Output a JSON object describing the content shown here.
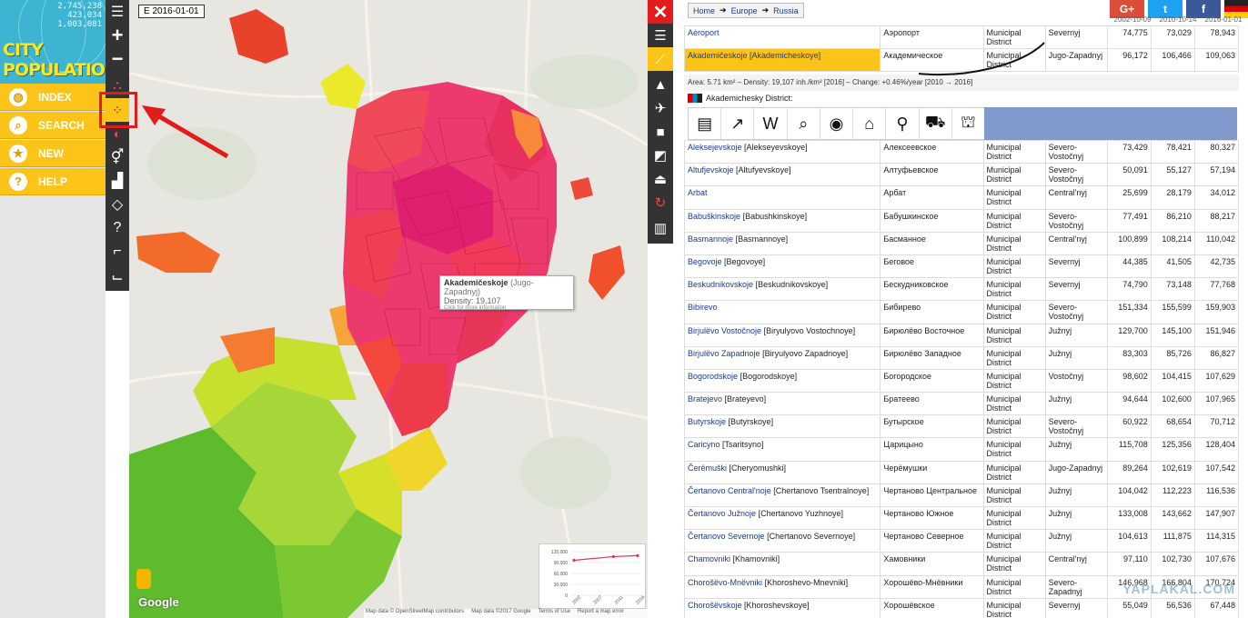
{
  "logo": {
    "stats": [
      "2,745,238",
      "423,034",
      "1,003,081"
    ],
    "title_line1": "CITY",
    "title_line2": "POPULATION"
  },
  "nav": [
    {
      "label": "INDEX",
      "icon": "globe-icon",
      "glyph": "◍"
    },
    {
      "label": "SEARCH",
      "icon": "search-icon",
      "glyph": "⌕"
    },
    {
      "label": "NEW",
      "icon": "star-icon",
      "glyph": "★"
    },
    {
      "label": "HELP",
      "icon": "help-icon",
      "glyph": "?"
    }
  ],
  "map": {
    "date": "E 2016-01-01",
    "tooltip": {
      "name": "Akademičeskoje",
      "region": "(Jugo-Zapadnyj)",
      "density": "Density: 19,107",
      "more": "Click for more information"
    },
    "google": "Google",
    "footer": [
      "Map data © OpenStreetMap contributors",
      "Map data ©2017 Google",
      "Terms of Use",
      "Report a map error"
    ],
    "mini_chart": {
      "y_ticks": [
        "120,000",
        "90,000",
        "60,000",
        "30,000",
        "0"
      ],
      "x_ticks": [
        "2002",
        "2007",
        "2011",
        "2016"
      ]
    }
  },
  "chart_data": {
    "type": "line",
    "x": [
      "2002",
      "2010",
      "2016"
    ],
    "series": [
      {
        "values": [
          96172,
          106466,
          109063
        ]
      }
    ],
    "ylim": [
      0,
      120000
    ]
  },
  "breadcrumb": [
    "Home",
    "Europe",
    "Russia"
  ],
  "social": [
    {
      "label": "G+",
      "color": "#dd4b39"
    },
    {
      "label": "t",
      "color": "#1da1f2"
    },
    {
      "label": "f",
      "color": "#3b5998"
    }
  ],
  "col_dates": [
    "2002-10-09",
    "2010-10-14",
    "2016-01-01"
  ],
  "top_rows": [
    {
      "lat": "Aėroport",
      "alt": "",
      "cyr": "Аэропорт",
      "type": "Municipal District",
      "region": "Severnyj",
      "p1": "74,775",
      "p2": "73,029",
      "p3": "78,943",
      "selected": false
    },
    {
      "lat": "Akademičeskoje",
      "alt": "[Akademicheskoye]",
      "cyr": "Академическое",
      "type": "Municipal District",
      "region": "Jugo-Zapadnyj",
      "p1": "96,172",
      "p2": "106,466",
      "p3": "109,063",
      "selected": true
    }
  ],
  "detail": {
    "info": "Area: 5.71 km² – Density: 19,107 inh./km² [2016] – Change: +0.46%/year [2010 → 2016]",
    "sub": "Akademichesky District:"
  },
  "icon_row": [
    {
      "name": "document-icon",
      "glyph": "▤"
    },
    {
      "name": "line-chart-icon",
      "glyph": "↗"
    },
    {
      "name": "wikipedia-icon",
      "glyph": "W"
    },
    {
      "name": "search-icon",
      "glyph": "⌕"
    },
    {
      "name": "camera-icon",
      "glyph": "◉"
    },
    {
      "name": "hotel-icon",
      "glyph": "⌂"
    },
    {
      "name": "restaurant-icon",
      "glyph": "⚲"
    },
    {
      "name": "shopping-cart-icon",
      "glyph": "⛟"
    },
    {
      "name": "museum-icon",
      "glyph": "⛫"
    }
  ],
  "rows": [
    {
      "lat": "Alekseјevskoje",
      "alt": "[Alekseyevskoye]",
      "cyr": "Алексеевское",
      "type": "Municipal District",
      "region": "Severo-Vostočnyj",
      "p1": "73,429",
      "p2": "78,421",
      "p3": "80,327"
    },
    {
      "lat": "Altufjevskoje",
      "alt": "[Altufyevskoye]",
      "cyr": "Алтуфьевское",
      "type": "Municipal District",
      "region": "Severo-Vostočnyj",
      "p1": "50,091",
      "p2": "55,127",
      "p3": "57,194"
    },
    {
      "lat": "Arbat",
      "alt": "",
      "cyr": "Арбат",
      "type": "Municipal District",
      "region": "Central'nyj",
      "p1": "25,699",
      "p2": "28,179",
      "p3": "34,012"
    },
    {
      "lat": "Babuškinskoje",
      "alt": "[Babushkinskoye]",
      "cyr": "Бабушкинское",
      "type": "Municipal District",
      "region": "Severo-Vostočnyj",
      "p1": "77,491",
      "p2": "86,210",
      "p3": "88,217"
    },
    {
      "lat": "Basmannoje",
      "alt": "[Basmannoye]",
      "cyr": "Басманное",
      "type": "Municipal District",
      "region": "Central'nyj",
      "p1": "100,899",
      "p2": "108,214",
      "p3": "110,042"
    },
    {
      "lat": "Begovoje",
      "alt": "[Begovoye]",
      "cyr": "Беговое",
      "type": "Municipal District",
      "region": "Severnyj",
      "p1": "44,385",
      "p2": "41,505",
      "p3": "42,735"
    },
    {
      "lat": "Beskudnikovskoje",
      "alt": "[Beskudnikovskoye]",
      "cyr": "Бескудниковское",
      "type": "Municipal District",
      "region": "Severnyj",
      "p1": "74,790",
      "p2": "73,148",
      "p3": "77,768"
    },
    {
      "lat": "Bibirevo",
      "alt": "",
      "cyr": "Бибирево",
      "type": "Municipal District",
      "region": "Severo-Vostočnyj",
      "p1": "151,334",
      "p2": "155,599",
      "p3": "159,903"
    },
    {
      "lat": "Birjulëvo Vostočnoje",
      "alt": "[Biryulyovo Vostochnoye]",
      "cyr": "Бирюлёво Восточное",
      "type": "Municipal District",
      "region": "Južnyj",
      "p1": "129,700",
      "p2": "145,100",
      "p3": "151,946"
    },
    {
      "lat": "Birjulëvo Zapadnoje",
      "alt": "[Biryulyovo Zapadnoye]",
      "cyr": "Бирюлёво Западное",
      "type": "Municipal District",
      "region": "Južnyj",
      "p1": "83,303",
      "p2": "85,726",
      "p3": "86,827"
    },
    {
      "lat": "Bogorodskoje",
      "alt": "[Bogorodskoye]",
      "cyr": "Богородское",
      "type": "Municipal District",
      "region": "Vostočnyj",
      "p1": "98,602",
      "p2": "104,415",
      "p3": "107,629"
    },
    {
      "lat": "Bratejevo",
      "alt": "[Brateyevo]",
      "cyr": "Братеево",
      "type": "Municipal District",
      "region": "Južnyj",
      "p1": "94,644",
      "p2": "102,600",
      "p3": "107,965"
    },
    {
      "lat": "Butyrskoje",
      "alt": "[Butyrskoye]",
      "cyr": "Бутырское",
      "type": "Municipal District",
      "region": "Severo-Vostočnyj",
      "p1": "60,922",
      "p2": "68,654",
      "p3": "70,712"
    },
    {
      "lat": "Caricyno",
      "alt": "[Tsaritsyno]",
      "cyr": "Царицыно",
      "type": "Municipal District",
      "region": "Južnyj",
      "p1": "115,708",
      "p2": "125,356",
      "p3": "128,404"
    },
    {
      "lat": "Čerëmuški",
      "alt": "[Cheryomushki]",
      "cyr": "Черёмушки",
      "type": "Municipal District",
      "region": "Jugo-Zapadnyj",
      "p1": "89,264",
      "p2": "102,619",
      "p3": "107,542"
    },
    {
      "lat": "Čertanovo Central'noje",
      "alt": "[Chertanovo Tsentralnoye]",
      "cyr": "Чертаново Центральное",
      "type": "Municipal District",
      "region": "Južnyj",
      "p1": "104,042",
      "p2": "112,223",
      "p3": "116,536"
    },
    {
      "lat": "Čertanovo Južnoje",
      "alt": "[Chertanovo Yuzhnoye]",
      "cyr": "Чертаново Южное",
      "type": "Municipal District",
      "region": "Južnyj",
      "p1": "133,008",
      "p2": "143,662",
      "p3": "147,907"
    },
    {
      "lat": "Čertanovo Severnoje",
      "alt": "[Chertanovo Severnoye]",
      "cyr": "Чертаново Северное",
      "type": "Municipal District",
      "region": "Južnyj",
      "p1": "104,613",
      "p2": "111,875",
      "p3": "114,315"
    },
    {
      "lat": "Chamovniki",
      "alt": "[Khamovniki]",
      "cyr": "Хамовники",
      "type": "Municipal District",
      "region": "Central'nyj",
      "p1": "97,110",
      "p2": "102,730",
      "p3": "107,676"
    },
    {
      "lat": "Chorošëvo-Mnëvniki",
      "alt": "[Khoroshevo-Mnevniki]",
      "cyr": "Хорошёво-Мнёвники",
      "type": "Municipal District",
      "region": "Severo-Zapadnyj",
      "p1": "146,968",
      "p2": "166,804",
      "p3": "170,724"
    },
    {
      "lat": "Chorošëvskoje",
      "alt": "[Khoroshevskoye]",
      "cyr": "Хорошёвское",
      "type": "Municipal District",
      "region": "Severnyj",
      "p1": "55,049",
      "p2": "56,536",
      "p3": "67,448"
    }
  ],
  "watermark": "YAPLAKAL.COM"
}
